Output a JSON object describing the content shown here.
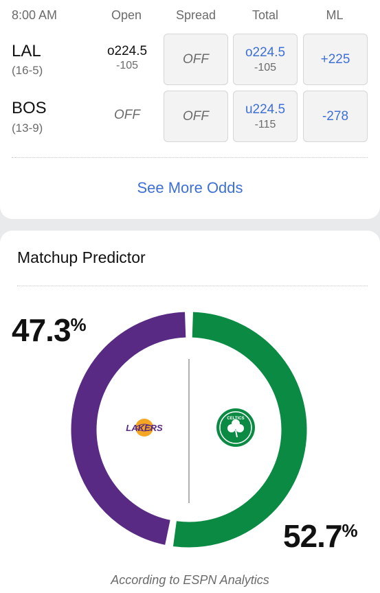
{
  "odds": {
    "time": "8:00 AM",
    "columns": [
      "Open",
      "Spread",
      "Total",
      "ML"
    ],
    "teams": [
      {
        "abbr": "LAL",
        "record": "(16-5)",
        "open_main": "o224.5",
        "open_sub": "-105",
        "spread": "OFF",
        "total_main": "o224.5",
        "total_sub": "-105",
        "ml": "+225"
      },
      {
        "abbr": "BOS",
        "record": "(13-9)",
        "open_main": "OFF",
        "spread": "OFF",
        "total_main": "u224.5",
        "total_sub": "-115",
        "ml": "-278"
      }
    ],
    "see_more": "See More Odds"
  },
  "predictor": {
    "title": "Matchup Predictor",
    "away_pct": "47.3",
    "home_pct": "52.7",
    "pct_symbol": "%",
    "away_share": 0.473,
    "home_share": 0.527,
    "away_color": "#582a83",
    "home_color": "#0a8a43",
    "away_logo_text": "LAKERS",
    "home_logo_text": "CELTICS",
    "footnote": "According to ESPN Analytics"
  }
}
